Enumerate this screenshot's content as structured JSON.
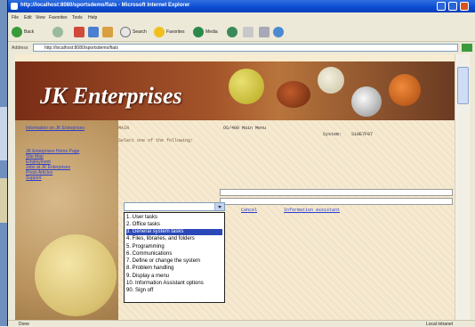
{
  "window": {
    "title": "http://localhost:8080/sportsdemo/fiats - Microsoft Internet Explorer"
  },
  "menu": [
    "File",
    "Edit",
    "View",
    "Favorites",
    "Tools",
    "Help"
  ],
  "toolbar": {
    "back": "Back",
    "search": "Search",
    "favorites": "Favorites",
    "media": "Media"
  },
  "address": {
    "label": "Address",
    "url": "http://localhost:8080/sportsdemo/fiats"
  },
  "brand": "JK Enterprises",
  "sidebar": {
    "heading": "Information on JK Enterprises",
    "links": [
      "JK Enterprises Home Page",
      "Site Map",
      "Employment",
      "Jobs at JK Enterprises",
      "Press Articles",
      "Support"
    ]
  },
  "screen": {
    "system_label": "MAIN",
    "title": "OS/400 Main Menu",
    "system_name_label": "System:",
    "system_name": "S10E7F07",
    "instruction": "Select one of the following:"
  },
  "dropdown": {
    "options": [
      "1. User tasks",
      "2. Office tasks",
      "3. General system tasks",
      "4. Files, libraries, and folders",
      "5. Programming",
      "6. Communications",
      "7. Define or change the system",
      "8. Problem handling",
      "9. Display a menu",
      "10. Information Assistant options",
      "90. Sign off"
    ],
    "selected_index": 2
  },
  "links": {
    "cancel": "Cancel",
    "information_assistant": "Information Assistant"
  },
  "status": {
    "left": "Done",
    "right": "Local intranet"
  },
  "colors": {
    "title_bar": "#0b4bd2",
    "selection": "#2b48b8",
    "link": "#2a3fcf",
    "banner": "#a4542a"
  }
}
